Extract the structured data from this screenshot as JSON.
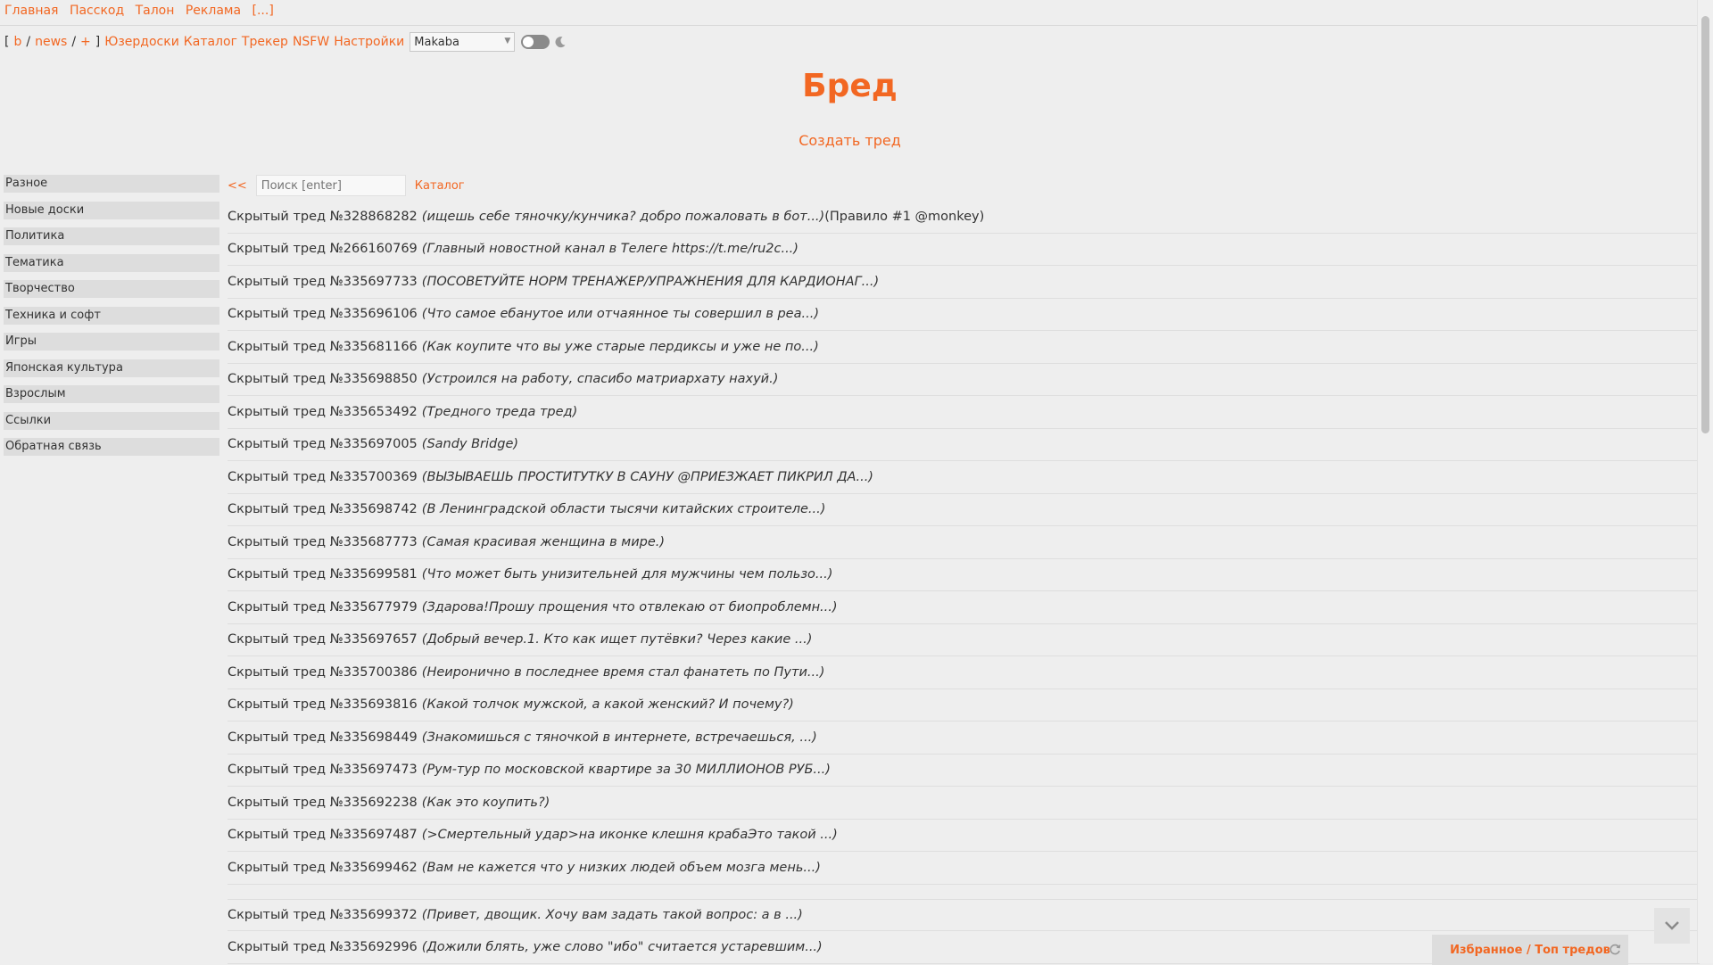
{
  "topnav": [
    "Главная",
    "Пасскод",
    "Талон",
    "Реклама",
    "[...]"
  ],
  "boardnav": {
    "open_bracket": "[",
    "b": "b",
    "slash1": "/",
    "news": "news",
    "slash2": "/",
    "plus": "+",
    "close_bracket": "]",
    "links": [
      "Юзердоски",
      "Каталог",
      "Трекер",
      "NSFW",
      "Настройки"
    ],
    "style_value": "Makaba"
  },
  "board_title": "Бред",
  "create_thread": "Создать тред",
  "sidebar": [
    "Разное",
    "Новые доски",
    "Политика",
    "Тематика",
    "Творчество",
    "Техника и софт",
    "Игры",
    "Японская культура",
    "Взрослым",
    "Ссылки",
    "Обратная связь"
  ],
  "threadbar": {
    "back": "<<",
    "search_placeholder": "Поиск [enter]",
    "catalog": "Каталог"
  },
  "threads": [
    {
      "label": "Скрытый тред №328868282",
      "subject": "(ищешь себе тяночку/кунчика? добро пожаловать в бот...)",
      "tail": "(Правило #1 @monkey)"
    },
    {
      "label": "Скрытый тред №266160769",
      "subject": "(Главный новостной канал в Телеге https://t.me/ru2c...)",
      "tail": ""
    },
    {
      "label": "Скрытый тред №335697733",
      "subject": "(ПОСОВЕТУЙТЕ НОРМ ТРЕНАЖЕР/УПРАЖНЕНИЯ ДЛЯ КАРДИОНАГ...)",
      "tail": ""
    },
    {
      "label": "Скрытый тред №335696106",
      "subject": "(Что самое ебанутое или отчаянное ты совершил в реа...)",
      "tail": ""
    },
    {
      "label": "Скрытый тред №335681166",
      "subject": "(Как коупите что вы уже старые пердиксы и уже не по...)",
      "tail": ""
    },
    {
      "label": "Скрытый тред №335698850",
      "subject": "(Устроился на работу, спасибо матриархату нахуй.)",
      "tail": ""
    },
    {
      "label": "Скрытый тред №335653492",
      "subject": "(Тредного треда тред)",
      "tail": ""
    },
    {
      "label": "Скрытый тред №335697005",
      "subject": "(Sandy Bridge)",
      "tail": ""
    },
    {
      "label": "Скрытый тред №335700369",
      "subject": "(ВЫЗЫВАЕШЬ ПРОСТИТУТКУ В САУНУ @ПРИЕЗЖАЕТ ПИКРИЛ ДА...)",
      "tail": ""
    },
    {
      "label": "Скрытый тред №335698742",
      "subject": "(В Ленинградской области тысячи китайских строителе...)",
      "tail": ""
    },
    {
      "label": "Скрытый тред №335687773",
      "subject": "(Самая красивая женщина в мире.)",
      "tail": ""
    },
    {
      "label": "Скрытый тред №335699581",
      "subject": "(Что может быть унизительней для мужчины чем пользо...)",
      "tail": ""
    },
    {
      "label": "Скрытый тред №335677979",
      "subject": "(Здарова!Прошу прощения что отвлекаю от биопроблемн...)",
      "tail": ""
    },
    {
      "label": "Скрытый тред №335697657",
      "subject": "(Добрый вечер.1. Кто как ищет путёвки? Через какие ...)",
      "tail": ""
    },
    {
      "label": "Скрытый тред №335700386",
      "subject": "(Неиронично в последнее время стал фанатеть по Пути...)",
      "tail": ""
    },
    {
      "label": "Скрытый тред №335693816",
      "subject": "(Какой толчок мужской, а какой женский? И почему?)",
      "tail": ""
    },
    {
      "label": "Скрытый тред №335698449",
      "subject": "(Знакомишься с тяночкой в интернете, встречаешься, ...)",
      "tail": ""
    },
    {
      "label": "Скрытый тред №335697473",
      "subject": "(Рум-тур по московской квартире за 30 МИЛЛИОНОВ РУБ...)",
      "tail": ""
    },
    {
      "label": "Скрытый тред №335692238",
      "subject": "(Как это коупить?)",
      "tail": ""
    },
    {
      "label": "Скрытый тред №335697487",
      "subject": "(>Смертельный удар>на иконке клешня крабаЭто такой ...)",
      "tail": ""
    },
    {
      "label": "Скрытый тред №335699462",
      "subject": "(Вам не кажется что у низких людей объем мозга мень...)",
      "tail": ""
    },
    {
      "label": "Скрытый тред №335699372",
      "subject": "(Привет, двощик. Хочу вам задать такой вопрос: а в ...)",
      "tail": ""
    },
    {
      "label": "Скрытый тред №335692996",
      "subject": "(Дожили блять, уже слово \"ибо\" считается устаревшим...)",
      "tail": ""
    }
  ],
  "favorites": "Избранное / Топ тредов",
  "colors": {
    "accent": "#f26722",
    "background": "#eeeeee",
    "sidebar_item": "#dddddd",
    "text": "#333333"
  }
}
